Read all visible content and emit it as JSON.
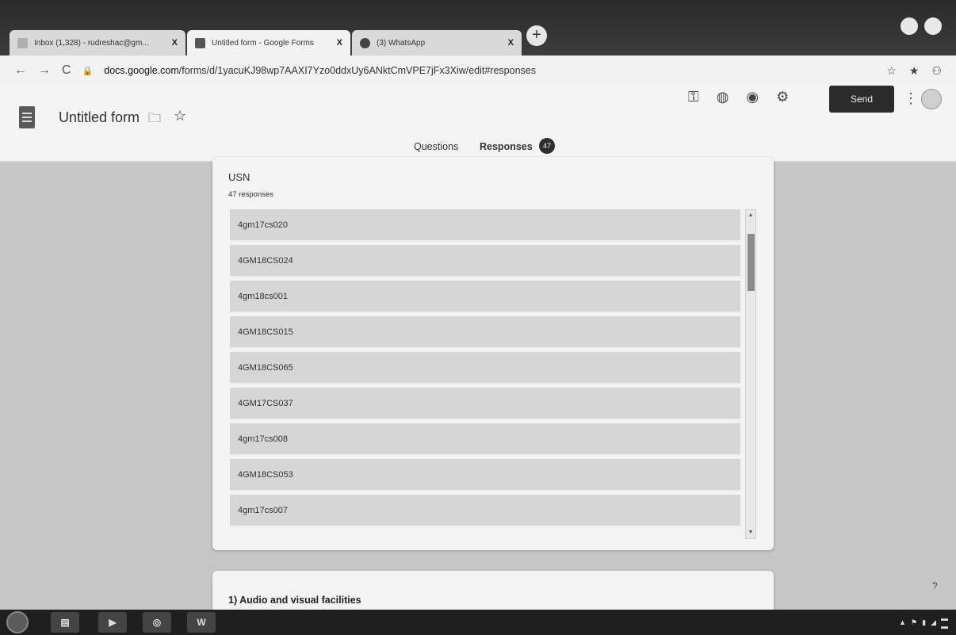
{
  "browser": {
    "tabs": [
      {
        "title": "Inbox (1,328) - rudreshac@gm...",
        "close": "X"
      },
      {
        "title": "Untitled form - Google Forms",
        "close": "X"
      },
      {
        "title": "(3) WhatsApp",
        "close": "X"
      }
    ],
    "new_tab": "+",
    "url_host": "docs.google.com",
    "url_path": "/forms/d/1yacuKJ98wp7AAXI7Yzo0ddxUy6ANktCmVPE7jFx3Xiw/edit#responses"
  },
  "header": {
    "form_title": "Untitled form",
    "send_label": "Send",
    "tabs": {
      "questions": "Questions",
      "responses": "Responses"
    },
    "responses_count": "47"
  },
  "question": {
    "title": "USN",
    "count_label": "47 responses",
    "responses": [
      "4gm17cs020",
      "4GM18CS024",
      "4gm18cs001",
      "4GM18CS015",
      "4GM18CS065",
      "4GM17CS037",
      "4gm17cs008",
      "4GM18CS053",
      "4gm17cs007"
    ]
  },
  "next_question": {
    "title": "1) Audio and visual facilities"
  },
  "taskbar": {
    "word_label": "W"
  }
}
